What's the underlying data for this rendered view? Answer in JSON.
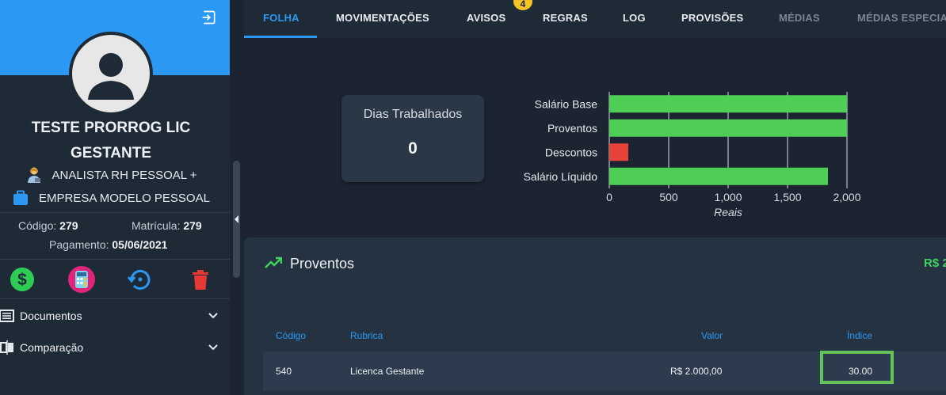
{
  "user": {
    "name_line1": "TESTE PRORROG LIC",
    "name_line2": "GESTANTE",
    "role": "ANALISTA RH PESSOAL +",
    "company": "EMPRESA MODELO PESSOAL",
    "codigo_label": "Código:",
    "codigo_value": "279",
    "matricula_label": "Matrícula:",
    "matricula_value": "279",
    "pagamento_label": "Pagamento:",
    "pagamento_value": "05/06/2021"
  },
  "sidebar_menu": [
    {
      "label": "Documentos",
      "icon": "list-icon"
    },
    {
      "label": "Comparação",
      "icon": "compare-icon"
    }
  ],
  "actions": [
    {
      "icon": "dollar-icon",
      "color": "#2ecc55"
    },
    {
      "icon": "calculator-icon",
      "color": "#e0247a"
    },
    {
      "icon": "history-icon",
      "color": "#2b99f3"
    },
    {
      "icon": "trash-icon",
      "color": "#e53935"
    }
  ],
  "tabs": [
    {
      "label": "FOLHA",
      "active": true
    },
    {
      "label": "MOVIMENTAÇÕES"
    },
    {
      "label": "AVISOS",
      "badge": "4"
    },
    {
      "label": "REGRAS"
    },
    {
      "label": "LOG"
    },
    {
      "label": "PROVISÕES"
    },
    {
      "label": "MÉDIAS",
      "dim": true
    },
    {
      "label": "MÉDIAS ESPECIA",
      "dim": true
    }
  ],
  "dias": {
    "label": "Dias Trabalhados",
    "value": "0"
  },
  "chart_data": {
    "type": "bar",
    "orientation": "horizontal",
    "categories": [
      "Salário Base",
      "Proventos",
      "Descontos",
      "Salário Líquido"
    ],
    "values": [
      2000,
      2000,
      160,
      1840
    ],
    "colors": [
      "#4fce55",
      "#4fce55",
      "#e8433a",
      "#4fce55"
    ],
    "xlabel": "Reais",
    "xlim": [
      0,
      2000
    ],
    "xticks": [
      "0",
      "500",
      "1,000",
      "1,500",
      "2,000"
    ],
    "xtick_values": [
      0,
      500,
      1000,
      1500,
      2000
    ],
    "grid": true
  },
  "proventos": {
    "title": "Proventos",
    "total": "R$ 2",
    "columns": {
      "codigo": "Código",
      "rubrica": "Rubrica",
      "valor": "Valor",
      "indice": "Índice"
    },
    "rows": [
      {
        "codigo": "540",
        "rubrica": "Licenca Gestante",
        "valor": "R$ 2.000,00",
        "indice": "30.00"
      }
    ]
  },
  "colors": {
    "accent": "#2b99f3",
    "positive": "#3ed35c",
    "negative": "#e8433a",
    "highlight": "#63c35a"
  }
}
